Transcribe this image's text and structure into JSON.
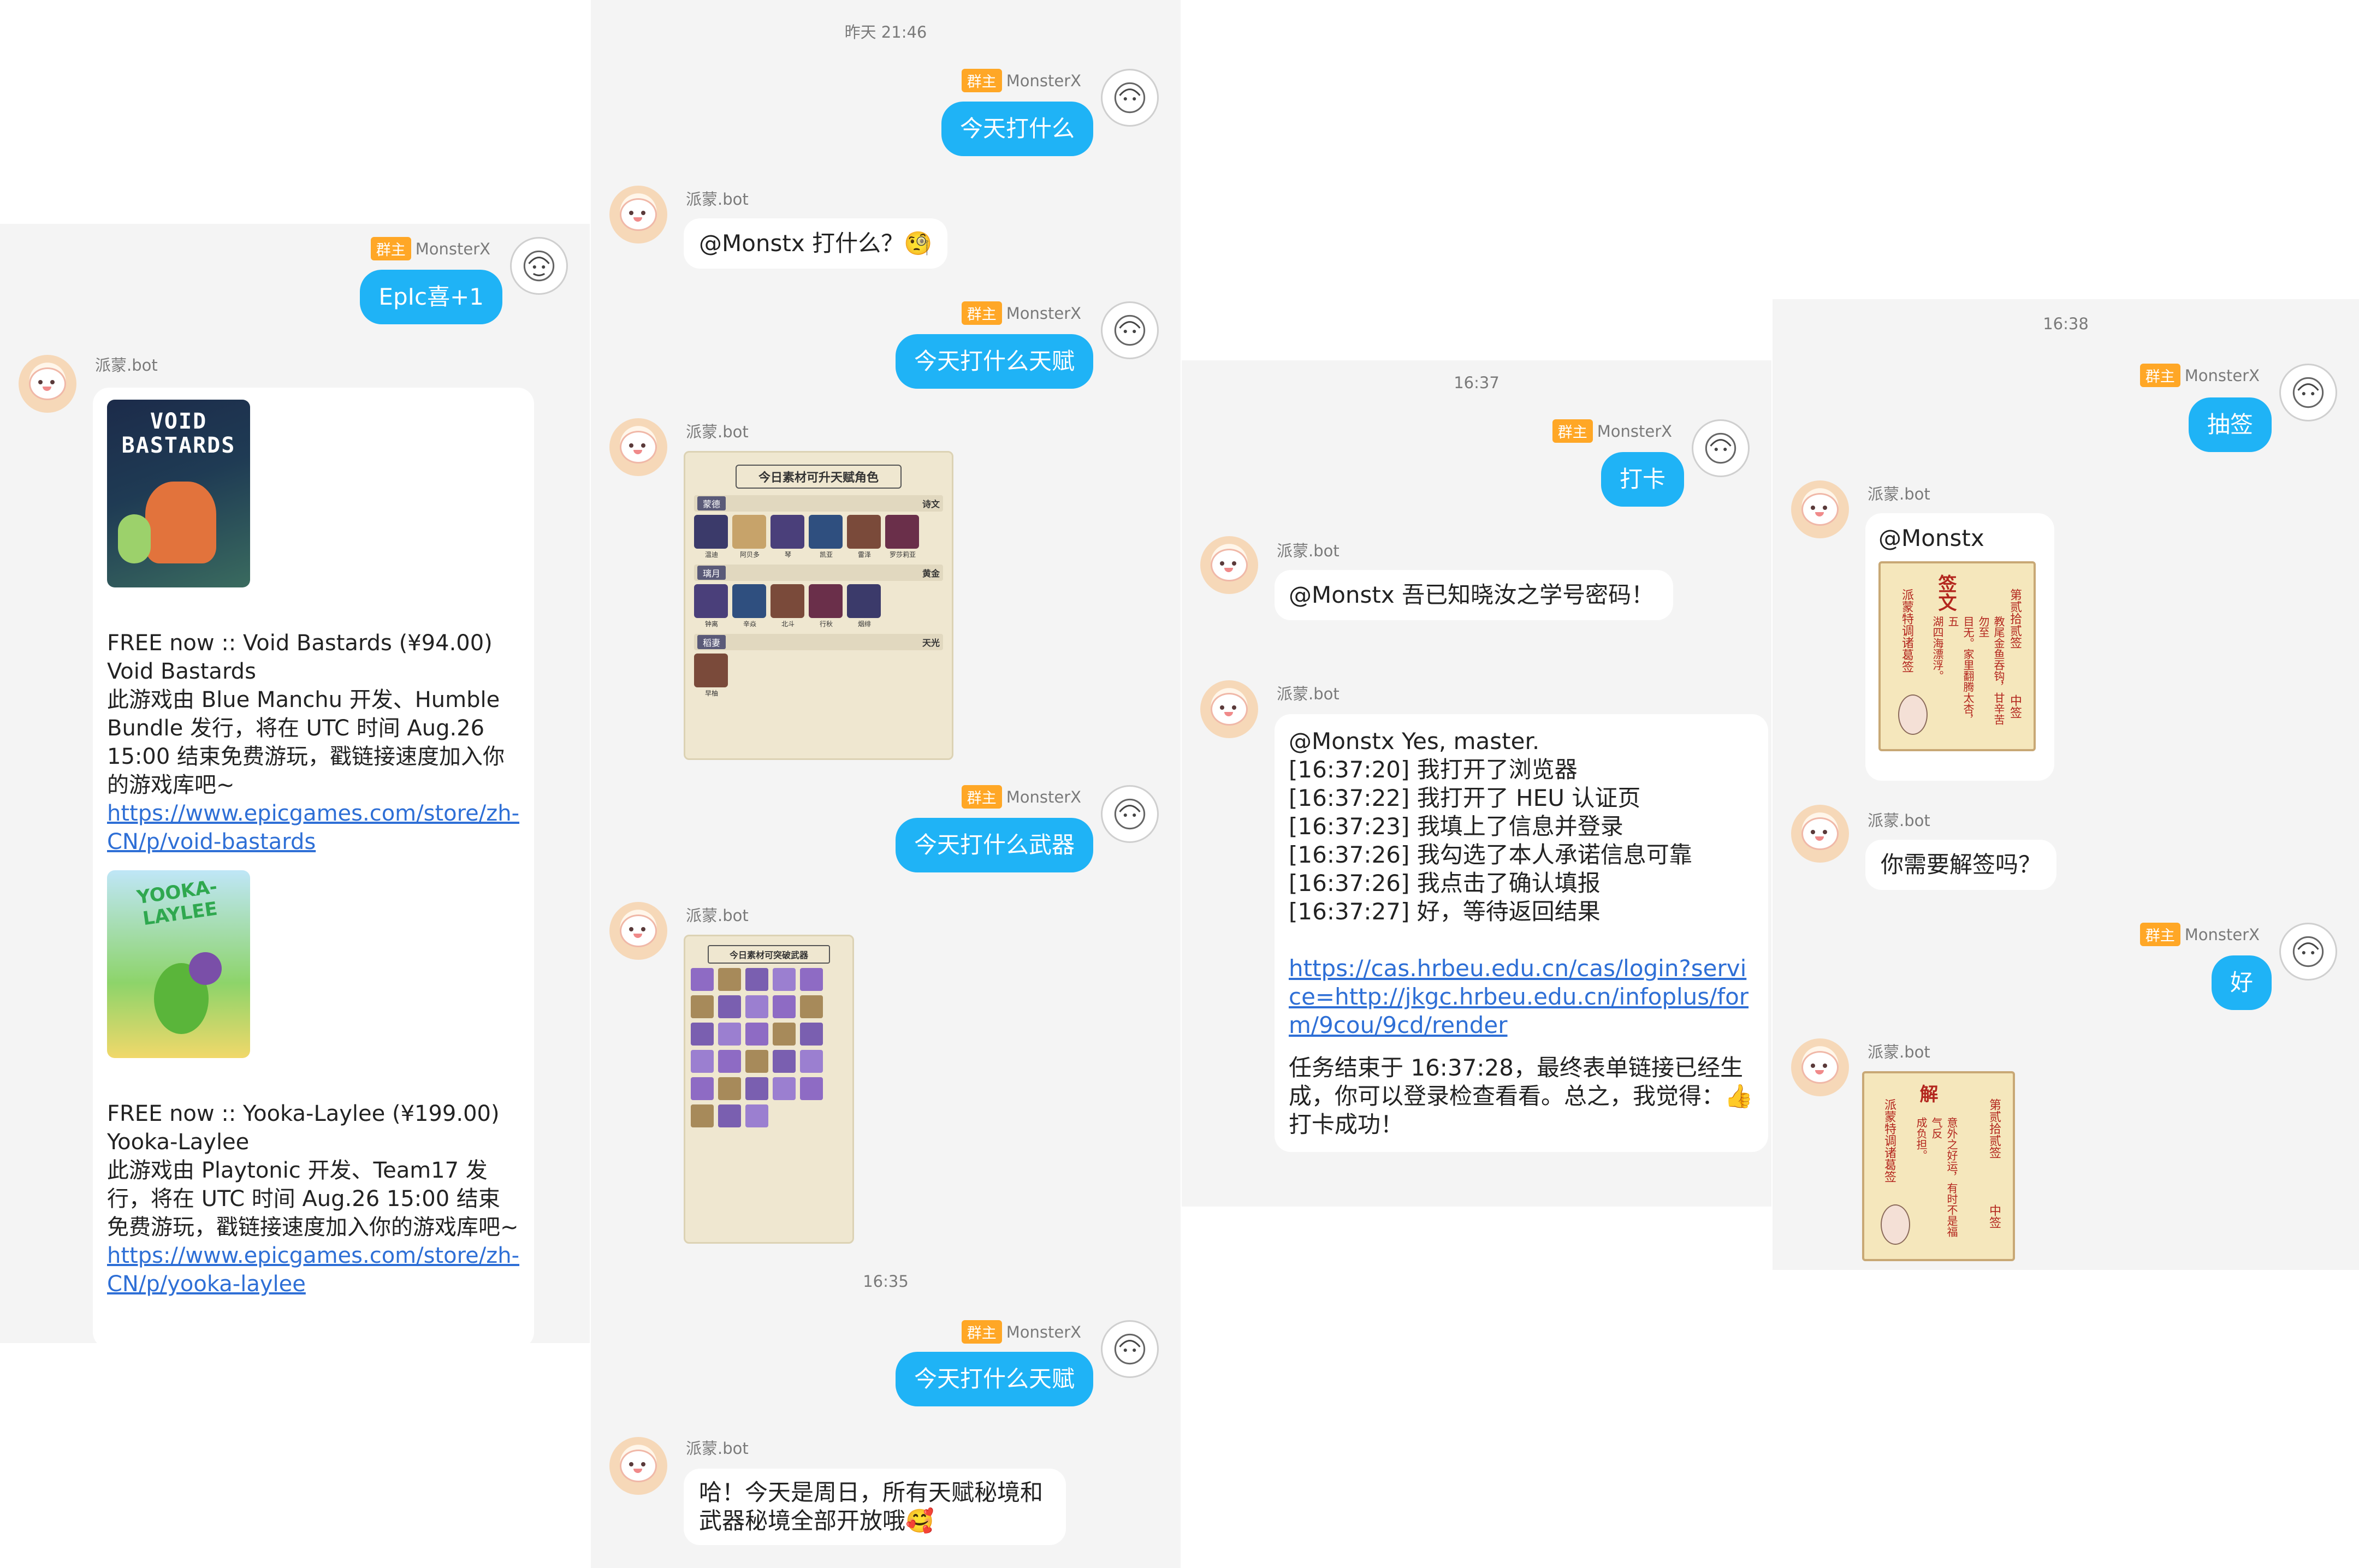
{
  "badge_label": "群主",
  "user_name": "MonsterX",
  "bot_name": "派蒙.bot",
  "panel1": {
    "user_msg": "EpIc喜+1",
    "game1_title": "VOID BASTARDS",
    "game1_text": "FREE now :: Void Bastards (¥94.00)\nVoid Bastards\n此游戏由 Blue Manchu 开发、Humble Bundle 发行，将在 UTC 时间 Aug.26 15:00 结束免费游玩，戳链接速度加入你的游戏库吧~",
    "game1_link": "https://www.epicgames.com/store/zh-CN/p/void-bastards",
    "game2_title": "YOOKA-LAYLEE",
    "game2_text": "FREE now :: Yooka-Laylee (¥199.00)\nYooka-Laylee\n此游戏由 Playtonic 开发、Team17 发行，将在 UTC 时间 Aug.26 15:00 结束免费游玩，戳链接速度加入你的游戏库吧~",
    "game2_link": "https://www.epicgames.com/store/zh-CN/p/yooka-laylee"
  },
  "panel2": {
    "ts1": "昨天 21:46",
    "u1": "今天打什么",
    "b1": "@Monstx  打什么？🧐",
    "u2": "今天打什么天赋",
    "card1_title": "今日素材可升天赋角色",
    "card1_rows": [
      {
        "region": "蒙德",
        "book": "诗文",
        "chars": [
          "温迪",
          "阿贝多",
          "琴",
          "凯亚",
          "雷泽",
          "罗莎莉亚"
        ]
      },
      {
        "region": "璃月",
        "book": "黄金",
        "chars": [
          "钟离",
          "辛焱",
          "北斗",
          "行秋",
          "烟绯"
        ]
      },
      {
        "region": "稻妻",
        "book": "天光",
        "chars": [
          "早柚"
        ]
      }
    ],
    "u3": "今天打什么武器",
    "card2_title": "今日素材可突破武器",
    "ts2": "16:35",
    "u4": "今天打什么天赋",
    "b4": "哈！今天是周日，所有天赋秘境和武器秘境全部开放哦🥰"
  },
  "panel3": {
    "ts1": "16:37",
    "u1": "打卡",
    "b1": "@Monstx  吾已知晓汝之学号密码！",
    "b2_lines": [
      "@Monstx  Yes, master.",
      "[16:37:20] 我打开了浏览器",
      "[16:37:22] 我打开了 HEU 认证页",
      "[16:37:23] 我填上了信息并登录",
      "[16:37:26] 我勾选了本人承诺信息可靠",
      "[16:37:26] 我点击了确认填报",
      "[16:37:27] 好，等待返回结果"
    ],
    "b2_link": "https://cas.hrbeu.edu.cn/cas/login?service=http://jkgc.hrbeu.edu.cn/infoplus/form/9cou/9cd/render",
    "b2_tail": "任务结束于 16:37:28，最终表单链接已经生成，你可以登录检查看看。总之，我觉得：👍 打卡成功！"
  },
  "panel4": {
    "ts1": "16:38",
    "u1": "抽签",
    "b1": "@Monstx",
    "stick1_title": "签文",
    "stick1_left": "派蒙特调诸葛签",
    "stick1_right": "第贰拾贰签",
    "stick1_grade": "中签",
    "stick1_poem": "教尾金鱼吞钩，甘辛苦勿至\n目无。家里翻腾太杏，五\n湖四海漂浮。",
    "b2": "你需要解签吗？",
    "u2": "好",
    "stick2_title": "解",
    "stick2_left": "派蒙特调诸葛签",
    "stick2_right": "第贰拾贰签",
    "stick2_grade": "中签",
    "stick2_poem": "意外之好运，有时不是福气反\n成负担。"
  }
}
